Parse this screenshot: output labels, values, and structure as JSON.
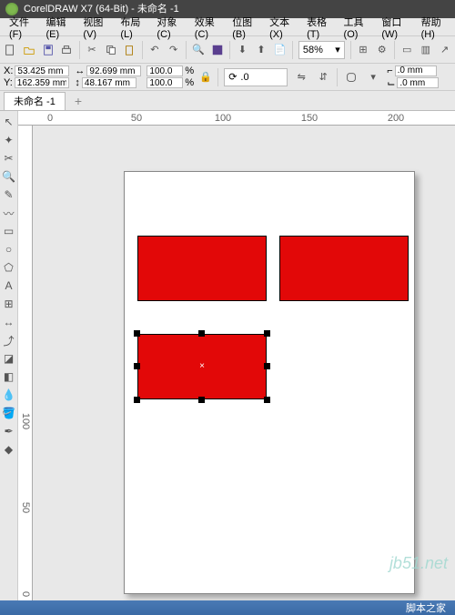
{
  "app": {
    "title": "CorelDRAW X7 (64-Bit) - 未命名 -1"
  },
  "menu": {
    "file": "文件(F)",
    "edit": "编辑(E)",
    "view": "视图(V)",
    "layout": "布局(L)",
    "object": "对象(C)",
    "effects": "效果(C)",
    "bitmap": "位图(B)",
    "text": "文本(X)",
    "table": "表格(T)",
    "tools": "工具(O)",
    "window": "窗口(W)",
    "help": "帮助(H)"
  },
  "toolbar": {
    "zoom": "58%"
  },
  "props": {
    "xlabel": "X:",
    "ylabel": "Y:",
    "x": "53.425 mm",
    "y": "162.359 mm",
    "w": "92.699 mm",
    "h": "48.167 mm",
    "sx": "100.0",
    "sy": "100.0",
    "pct": "%",
    "rot": ".0",
    "ow": ".0 mm",
    "oh": ".0 mm"
  },
  "doc": {
    "tab": "未命名 -1",
    "plus": "+"
  },
  "ruler": {
    "h0": "0",
    "h50": "50",
    "h100": "100",
    "h150": "150",
    "h200": "200",
    "v0": "0",
    "v50": "50",
    "v100": "100"
  },
  "watermark": "jb51.net",
  "footer": "脚本之家"
}
